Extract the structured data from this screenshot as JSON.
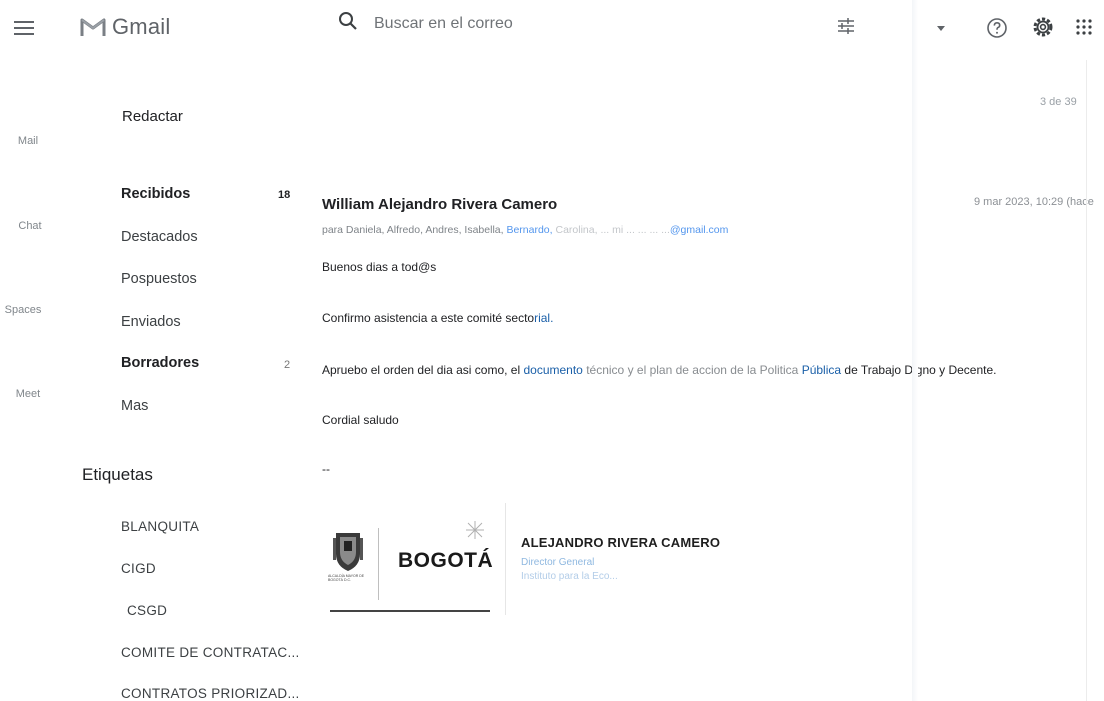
{
  "header": {
    "app_name": "Gmail",
    "search_placeholder": "Buscar en el correo",
    "icons": [
      "menu-icon",
      "gmail-logo-icon",
      "search-icon",
      "tune-icon",
      "chevron-down-icon",
      "help-icon",
      "gear-icon",
      "apps-icon"
    ]
  },
  "rail": {
    "items": [
      {
        "label": "Mail",
        "icon": "mail-icon"
      },
      {
        "label": "Chat",
        "icon": "chat-icon"
      },
      {
        "label": "Spaces",
        "icon": "spaces-icon"
      },
      {
        "label": "Meet",
        "icon": "meet-icon"
      }
    ]
  },
  "nav": {
    "compose_label": "Redactar",
    "items": [
      {
        "label": "Recibidos",
        "count": "18",
        "bold": true
      },
      {
        "label": "Destacados",
        "count": "",
        "bold": false
      },
      {
        "label": "Pospuestos",
        "count": "",
        "bold": false
      },
      {
        "label": "Enviados",
        "count": "",
        "bold": false
      },
      {
        "label": "Borradores",
        "count": "2",
        "bold": true
      },
      {
        "label": "Mas",
        "count": "",
        "bold": false
      }
    ],
    "labels_title": "Etiquetas",
    "labels": [
      "BLANQUITA",
      "CIGD",
      "CSGD",
      "COMITE DE CONTRATAC...",
      "CONTRATOS PRIORIZAD..."
    ]
  },
  "email": {
    "counter": "3 de 39",
    "sender": "William Alejandro Rivera Camero",
    "date": "9 mar 2023, 10:29 (hace",
    "recipients_prefix": "para Daniela, Alfredo, Andres, Isabella,",
    "recipients_blue": "Bernardo,",
    "recipients_faint": "Carolina, ... mi ... ... ... ...",
    "recipients_suffix": "@gmail.com",
    "greeting": "Buenos dias a tod@s",
    "line1_text": "Confirmo asistencia a este comité secto",
    "line1_link": "rial.",
    "line2_a": "Apruebo el orden del dia asi como, el",
    "line2_link1": "documento",
    "line2_b": "técnico",
    "line2_faint": "y el plan de accion de la Politica",
    "line2_link2": "Pública",
    "line2_c": "de Trabajo Digno y Decente.",
    "closing": "Cordial saludo",
    "separator": "--",
    "signature": {
      "logo_text": "BOGOTÁ",
      "crest_caption": "ALCALDÍA MAYOR DE BOGOTÁ D.C.",
      "name": "ALEJANDRO RIVERA CAMERO",
      "role": "Director General",
      "org": "Instituto para la Eco..."
    }
  },
  "colors": {
    "link": "#1a73e8",
    "text": "#202124",
    "muted": "#5f6368"
  }
}
